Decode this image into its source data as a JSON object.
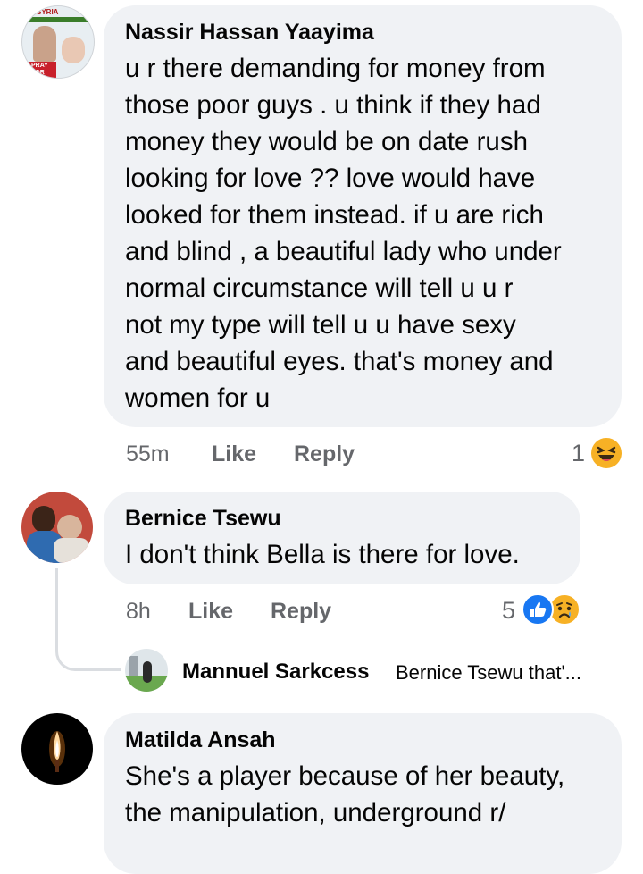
{
  "comments": [
    {
      "author": "Nassir Hassan Yaayima",
      "avatar_caption_top": "SYRIA",
      "avatar_caption_bottom": "PRAY FOR",
      "lines": [
        "u r there demanding for money from",
        "those poor guys . u think if they had",
        "money they would be on date rush",
        "looking for love ??  love would have",
        "looked for them instead. if u are rich",
        "and blind , a beautiful lady who under",
        "normal circumstance will tell u u r",
        "not my type will tell u u have sexy",
        "and beautiful eyes.  that's money and",
        "women for u"
      ],
      "time": "55m",
      "like_label": "Like",
      "reply_label": "Reply",
      "reaction_count": "1",
      "reactions": [
        "haha-emoji-icon"
      ]
    },
    {
      "author": "Bernice Tsewu",
      "lines": [
        "I don't think Bella is there for love."
      ],
      "time": "8h",
      "like_label": "Like",
      "reply_label": "Reply",
      "reaction_count": "5",
      "reactions": [
        "like-reaction-icon",
        "sad-emoji-icon"
      ],
      "reply_preview": {
        "author": "Mannuel Sarkcess",
        "snippet": "Bernice Tsewu that'..."
      }
    },
    {
      "author": "Matilda Ansah",
      "lines": [
        "She's a player because of her beauty,",
        "the manipulation, underground r/"
      ]
    }
  ],
  "colors": {
    "bubble": "#f0f2f5",
    "meta_text": "#65676b",
    "like_blue": "#1877f2",
    "emoji_yellow": "#f7b125"
  }
}
